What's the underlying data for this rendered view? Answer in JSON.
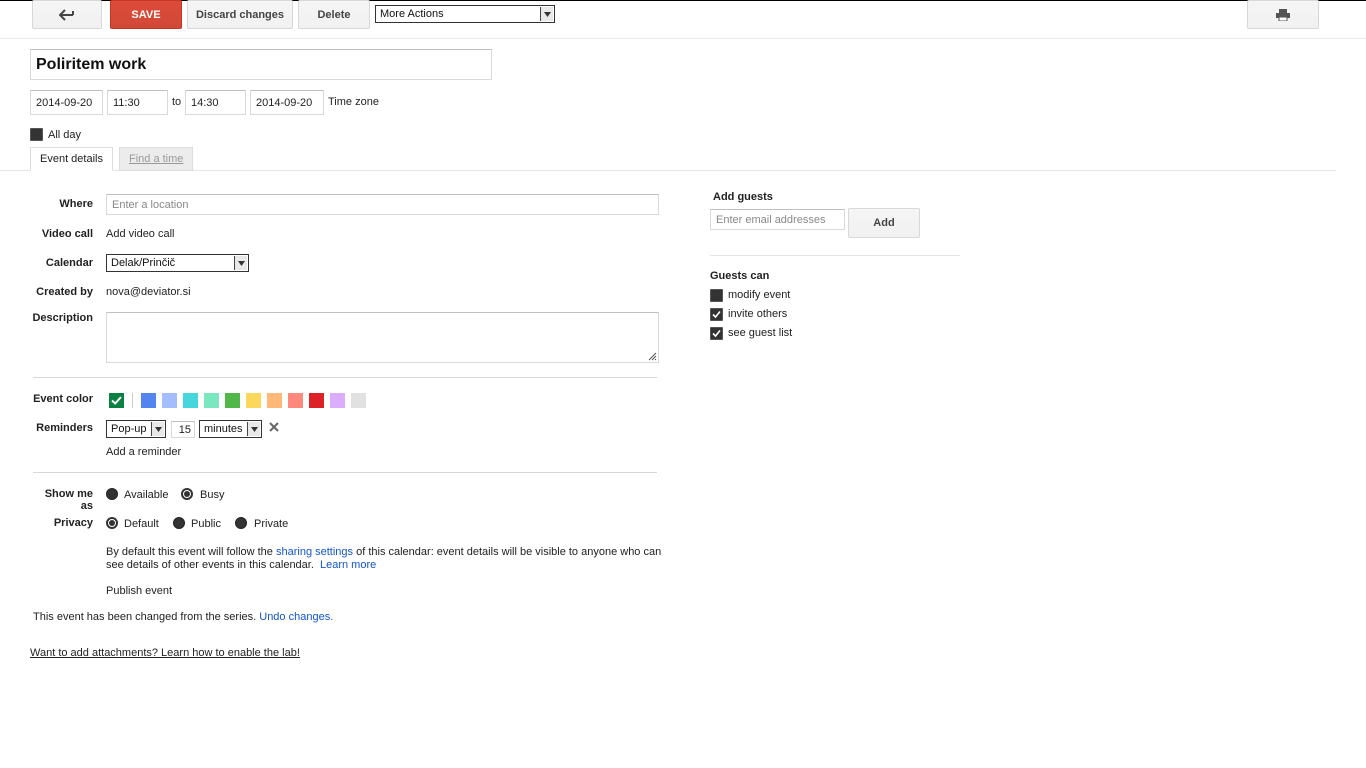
{
  "toolbar": {
    "save": "SAVE",
    "discard": "Discard changes",
    "delete": "Delete",
    "more_actions": "More Actions"
  },
  "event": {
    "title": "Poliritem work",
    "start_date": "2014-09-20",
    "start_time": "11:30",
    "to": "to",
    "end_time": "14:30",
    "end_date": "2014-09-20",
    "time_zone": "Time zone",
    "all_day": "All day"
  },
  "tabs": [
    "Event details",
    "Find a time"
  ],
  "details": {
    "where_label": "Where",
    "where_placeholder": "Enter a location",
    "video_label": "Video call",
    "video_link": "Add video call",
    "calendar_label": "Calendar",
    "calendar_value": "Delak/Prinčič",
    "created_label": "Created by",
    "created_value": "nova@deviator.si",
    "description_label": "Description",
    "color_label": "Event color",
    "colors": [
      "#0b8043",
      "#5484ed",
      "#a4bdfc",
      "#46d6db",
      "#7ae7bf",
      "#51b749",
      "#fbd75b",
      "#ffb878",
      "#ff887c",
      "#dc2127",
      "#dbadff",
      "#e1e1e1"
    ],
    "reminders_label": "Reminders",
    "reminder_type": "Pop-up",
    "reminder_value": "15",
    "reminder_unit": "minutes",
    "add_reminder": "Add a reminder",
    "show_as_label": "Show me as",
    "available": "Available",
    "busy": "Busy",
    "privacy_label": "Privacy",
    "privacy_default": "Default",
    "privacy_public": "Public",
    "privacy_private": "Private",
    "privacy_note_1": "By default this event will follow the",
    "sharing_settings": "sharing settings",
    "privacy_note_2": "of this calendar: event details will be visible to anyone who can",
    "privacy_note_3": "see details of other events in this calendar.",
    "learn_more": "Learn more",
    "publish": "Publish event",
    "series_note": "This event has been changed from the series.",
    "undo": "Undo changes.",
    "attachments": "Want to add attachments? Learn how to enable the lab!"
  },
  "guests": {
    "add_label": "Add guests",
    "email_placeholder": "Enter email addresses",
    "add_button": "Add",
    "can_label": "Guests can",
    "modify": "modify event",
    "invite": "invite others",
    "see_list": "see guest list"
  }
}
